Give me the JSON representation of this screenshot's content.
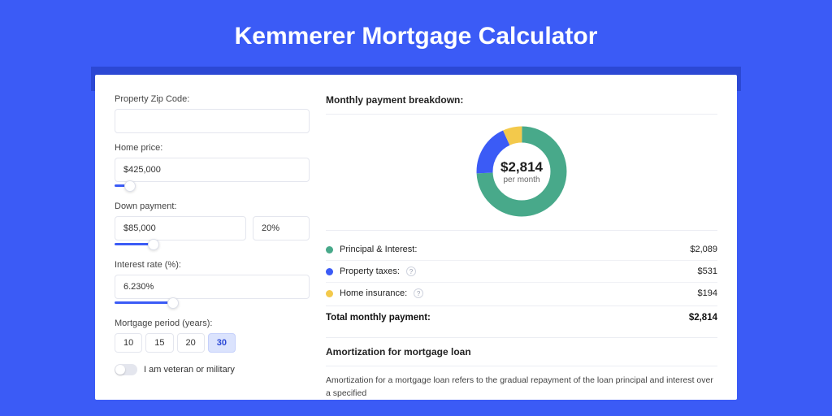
{
  "title": "Kemmerer Mortgage Calculator",
  "form": {
    "zip_label": "Property Zip Code:",
    "zip_value": "",
    "home_price_label": "Home price:",
    "home_price_value": "$425,000",
    "home_price_slider_pct": 8,
    "down_label": "Down payment:",
    "down_value": "$85,000",
    "down_pct": "20%",
    "down_slider_pct": 20,
    "rate_label": "Interest rate (%):",
    "rate_value": "6.230%",
    "rate_slider_pct": 30,
    "period_label": "Mortgage period (years):",
    "period_options": [
      "10",
      "15",
      "20",
      "30"
    ],
    "period_active": "30",
    "veteran_label": "I am veteran or military"
  },
  "breakdown": {
    "heading": "Monthly payment breakdown:",
    "total_amount": "$2,814",
    "per_month": "per month",
    "rows": [
      {
        "label": "Principal & Interest:",
        "value": "$2,089",
        "color": "#48a98a",
        "help": false
      },
      {
        "label": "Property taxes:",
        "value": "$531",
        "color": "#3b5bf6",
        "help": true
      },
      {
        "label": "Home insurance:",
        "value": "$194",
        "color": "#f3c94b",
        "help": true
      }
    ],
    "total_label": "Total monthly payment:",
    "total_value": "$2,814"
  },
  "chart_data": {
    "type": "pie",
    "title": "Monthly payment breakdown",
    "series": [
      {
        "name": "Principal & Interest",
        "value": 2089,
        "color": "#48a98a"
      },
      {
        "name": "Property taxes",
        "value": 531,
        "color": "#3b5bf6"
      },
      {
        "name": "Home insurance",
        "value": 194,
        "color": "#f3c94b"
      }
    ],
    "total": 2814
  },
  "amort": {
    "heading": "Amortization for mortgage loan",
    "text": "Amortization for a mortgage loan refers to the gradual repayment of the loan principal and interest over a specified"
  }
}
